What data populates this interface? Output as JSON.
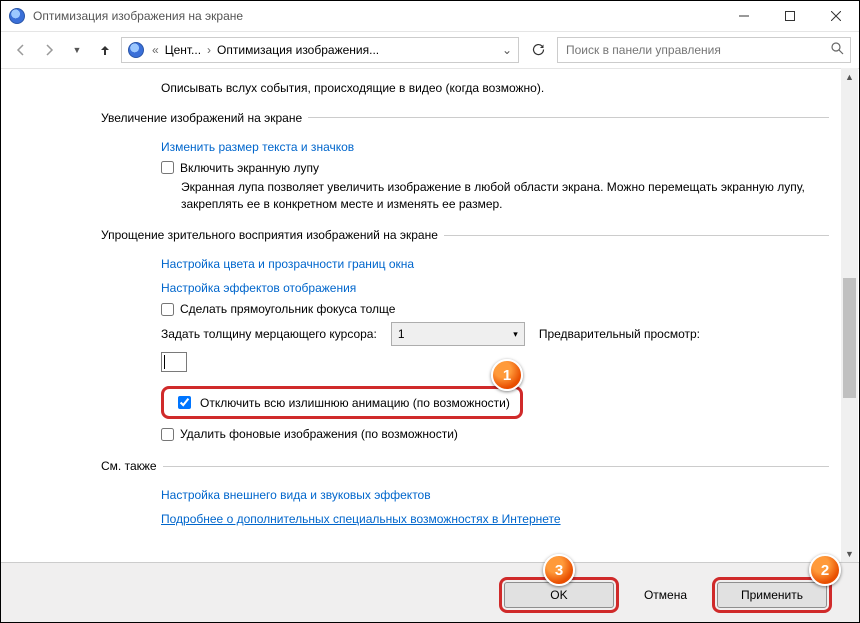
{
  "window": {
    "title": "Оптимизация изображения на экране"
  },
  "addressbar": {
    "crumb1": "Цент...",
    "crumb2": "Оптимизация изображения..."
  },
  "search": {
    "placeholder": "Поиск в панели управления"
  },
  "content": {
    "topline": "Описывать вслух события, происходящие в видео (когда возможно).",
    "sec_magnify": {
      "legend": "Увеличение изображений на экране",
      "link_size": "Изменить размер текста и значков",
      "cb_magnifier": "Включить экранную лупу",
      "desc": "Экранная лупа позволяет увеличить изображение в любой области экрана. Можно перемещать экранную лупу, закреплять ее в конкретном месте и изменять ее размер."
    },
    "sec_visual": {
      "legend": "Упрощение зрительного восприятия изображений на экране",
      "link_color": "Настройка цвета и прозрачности границ окна",
      "link_effects": "Настройка эффектов отображения",
      "cb_focus": "Сделать прямоугольник фокуса толще",
      "cursor_label": "Задать толщину мерцающего курсора:",
      "cursor_value": "1",
      "preview_label": "Предварительный просмотр:",
      "cb_disable_anim": "Отключить всю излишнюю анимацию (по возможности)",
      "cb_remove_bg": "Удалить фоновые изображения (по возможности)"
    },
    "sec_seealso": {
      "legend": "См. также",
      "link_appearance": "Настройка внешнего вида и звуковых эффектов",
      "link_more": "Подробнее о дополнительных специальных возможностях в Интернете"
    }
  },
  "buttons": {
    "ok": "OK",
    "cancel": "Отмена",
    "apply": "Применить"
  },
  "callouts": {
    "c1": "1",
    "c2": "2",
    "c3": "3"
  }
}
